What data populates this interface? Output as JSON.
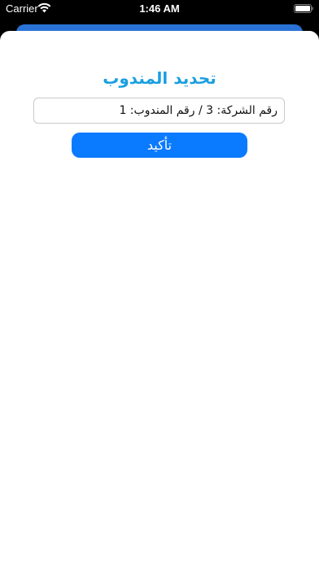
{
  "status_bar": {
    "carrier": "Carrier",
    "time": "1:46 AM",
    "icons": [
      "wifi-icon",
      "battery-icon"
    ]
  },
  "dialog": {
    "title": "تحديد المندوب",
    "input_value": "رقم الشركة: 3 / رقم المندوب: 1",
    "confirm_label": "تأكيد"
  },
  "colors": {
    "title": "#1a9fe0",
    "button": "#0a7aff",
    "back_sheet": "#2a73d6"
  }
}
